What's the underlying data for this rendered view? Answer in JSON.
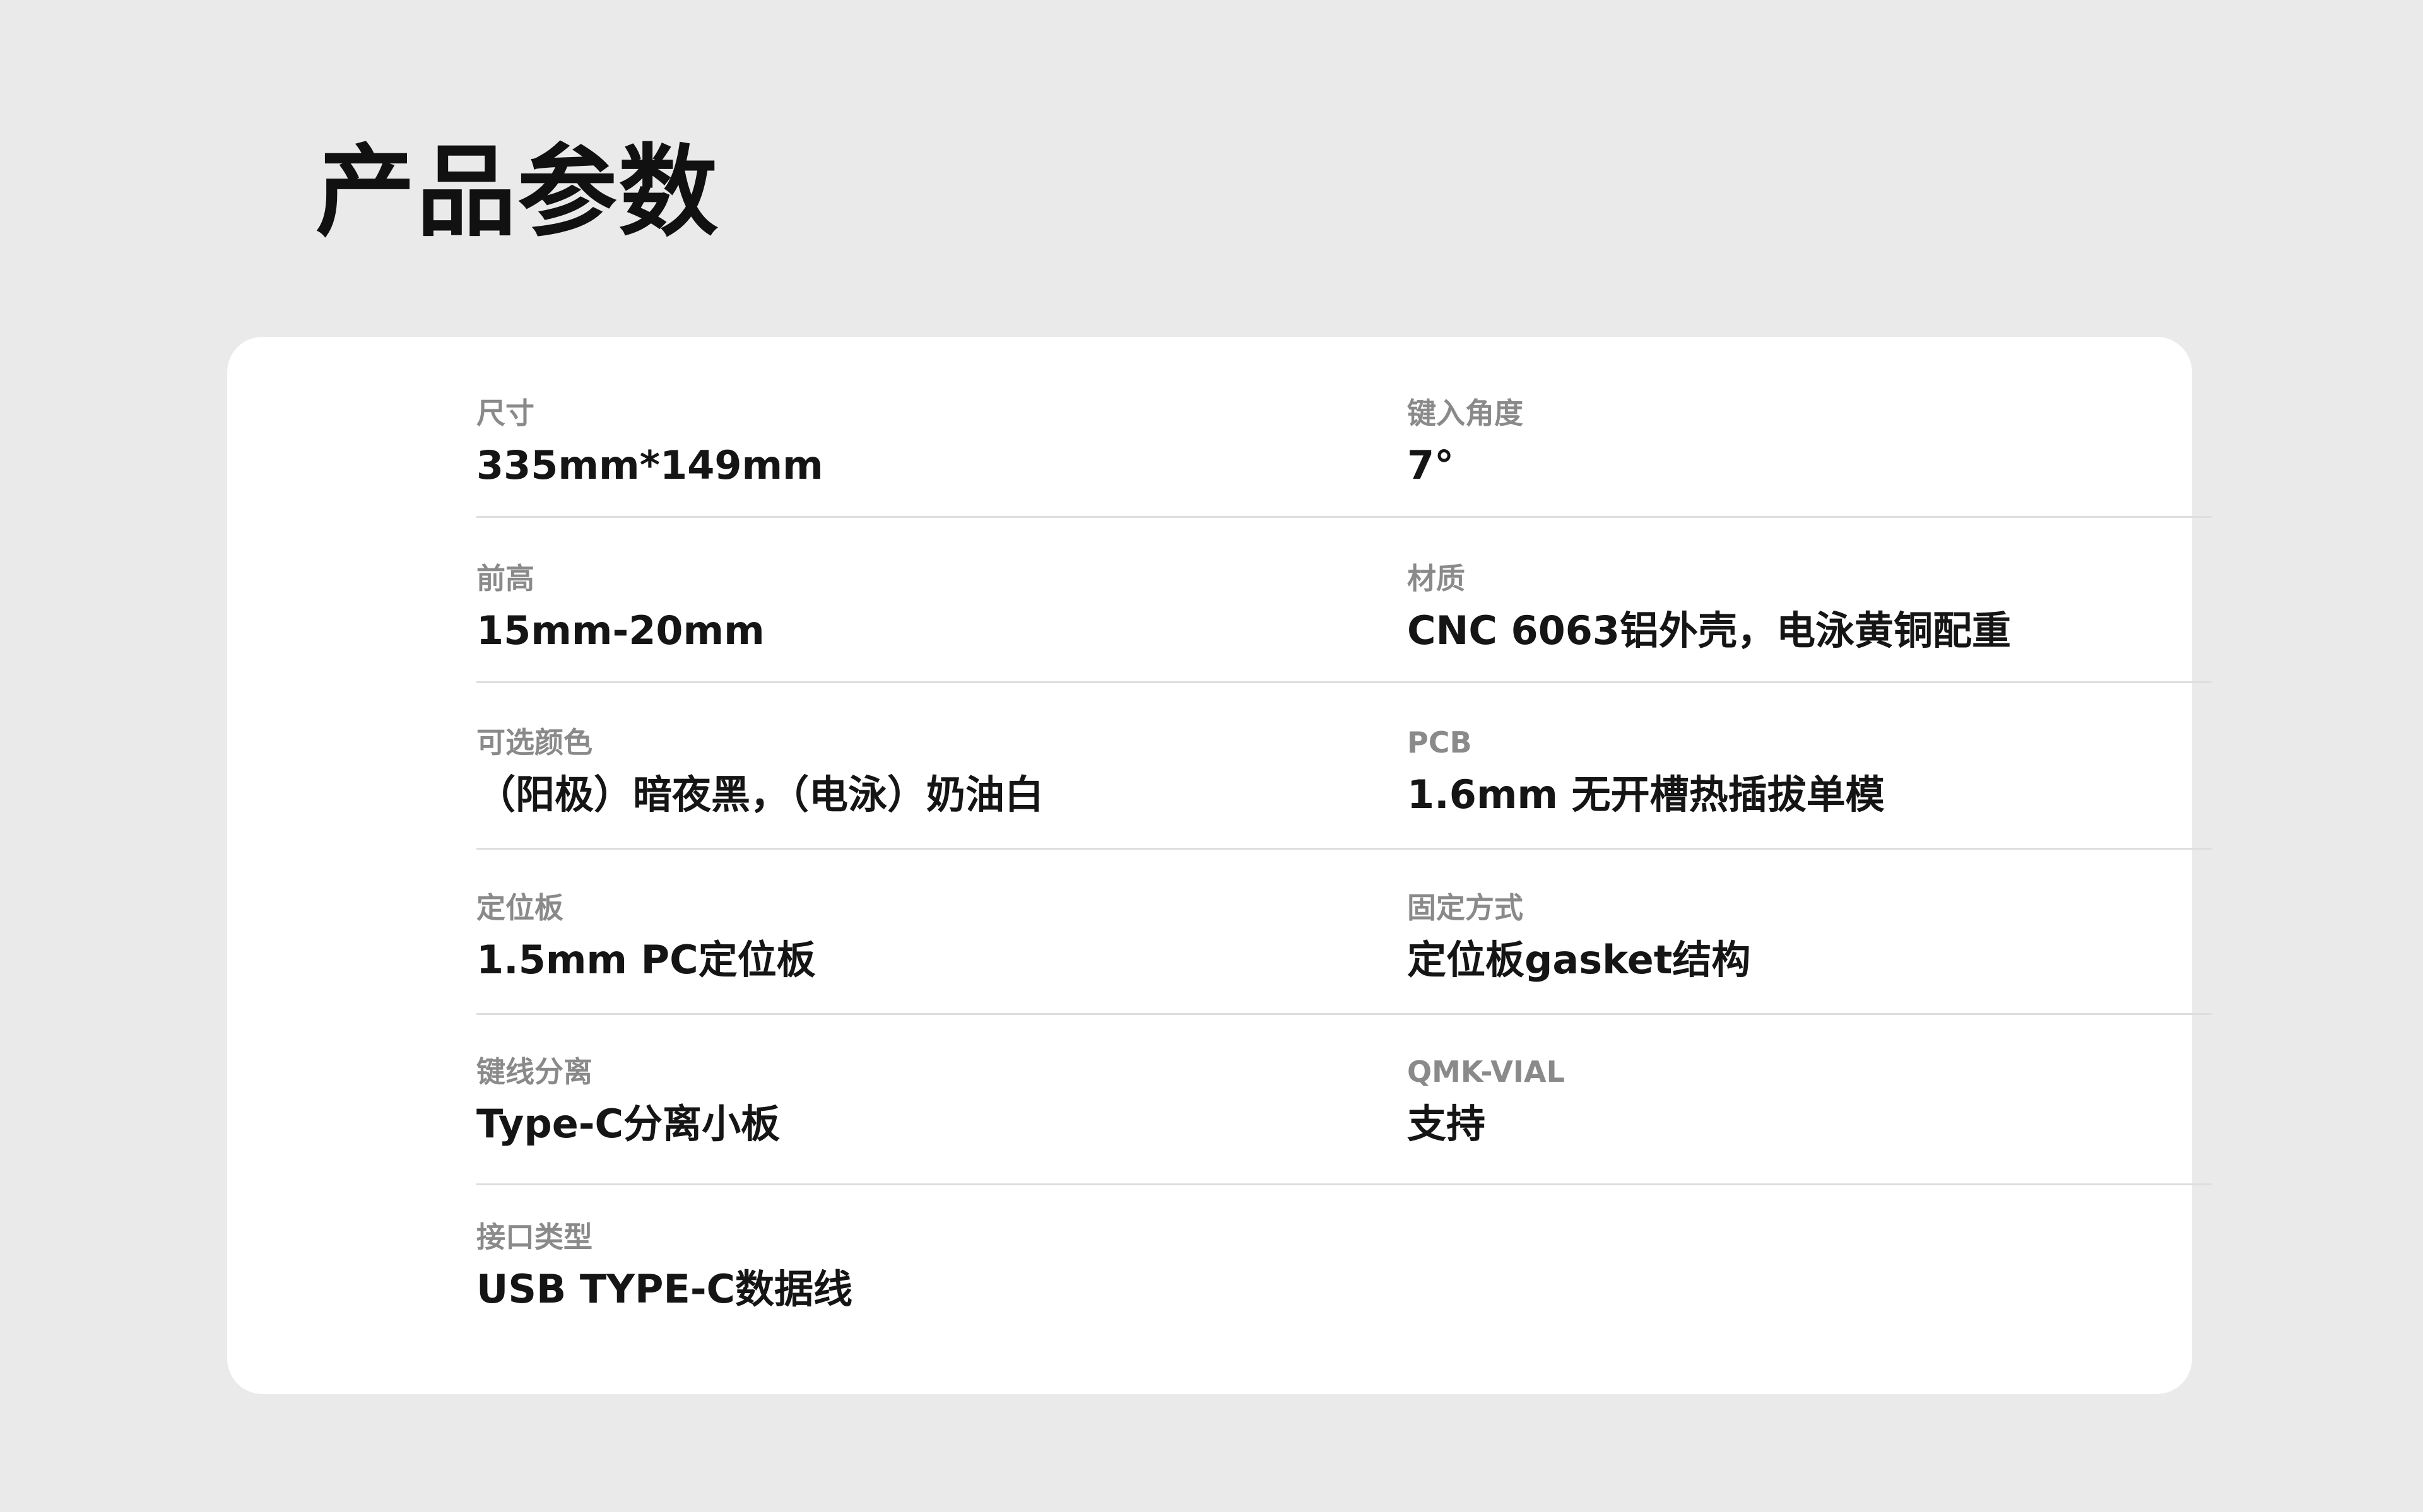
{
  "page": {
    "title": "产品参数"
  },
  "specs": {
    "left": [
      {
        "label": "尺寸",
        "value": "335mm*149mm"
      },
      {
        "label": "前高",
        "value": "15mm-20mm"
      },
      {
        "label": "可选颜色",
        "value": "（阳极）暗夜黑，（电泳）奶油白"
      },
      {
        "label": "定位板",
        "value": "1.5mm PC定位板"
      },
      {
        "label": "键线分离",
        "value": "Type-C分离小板"
      },
      {
        "label": "接口类型",
        "value": "USB TYPE-C数据线"
      }
    ],
    "right": [
      {
        "label": "键入角度",
        "value": "7°"
      },
      {
        "label": "材质",
        "value": "CNC 6063铝外壳，电泳黄铜配重"
      },
      {
        "label": "PCB",
        "value": "1.6mm 无开槽热插拔单模"
      },
      {
        "label": "固定方式",
        "value": "定位板gasket结构"
      },
      {
        "label": "QMK-VIAL",
        "value": "支持"
      }
    ]
  }
}
